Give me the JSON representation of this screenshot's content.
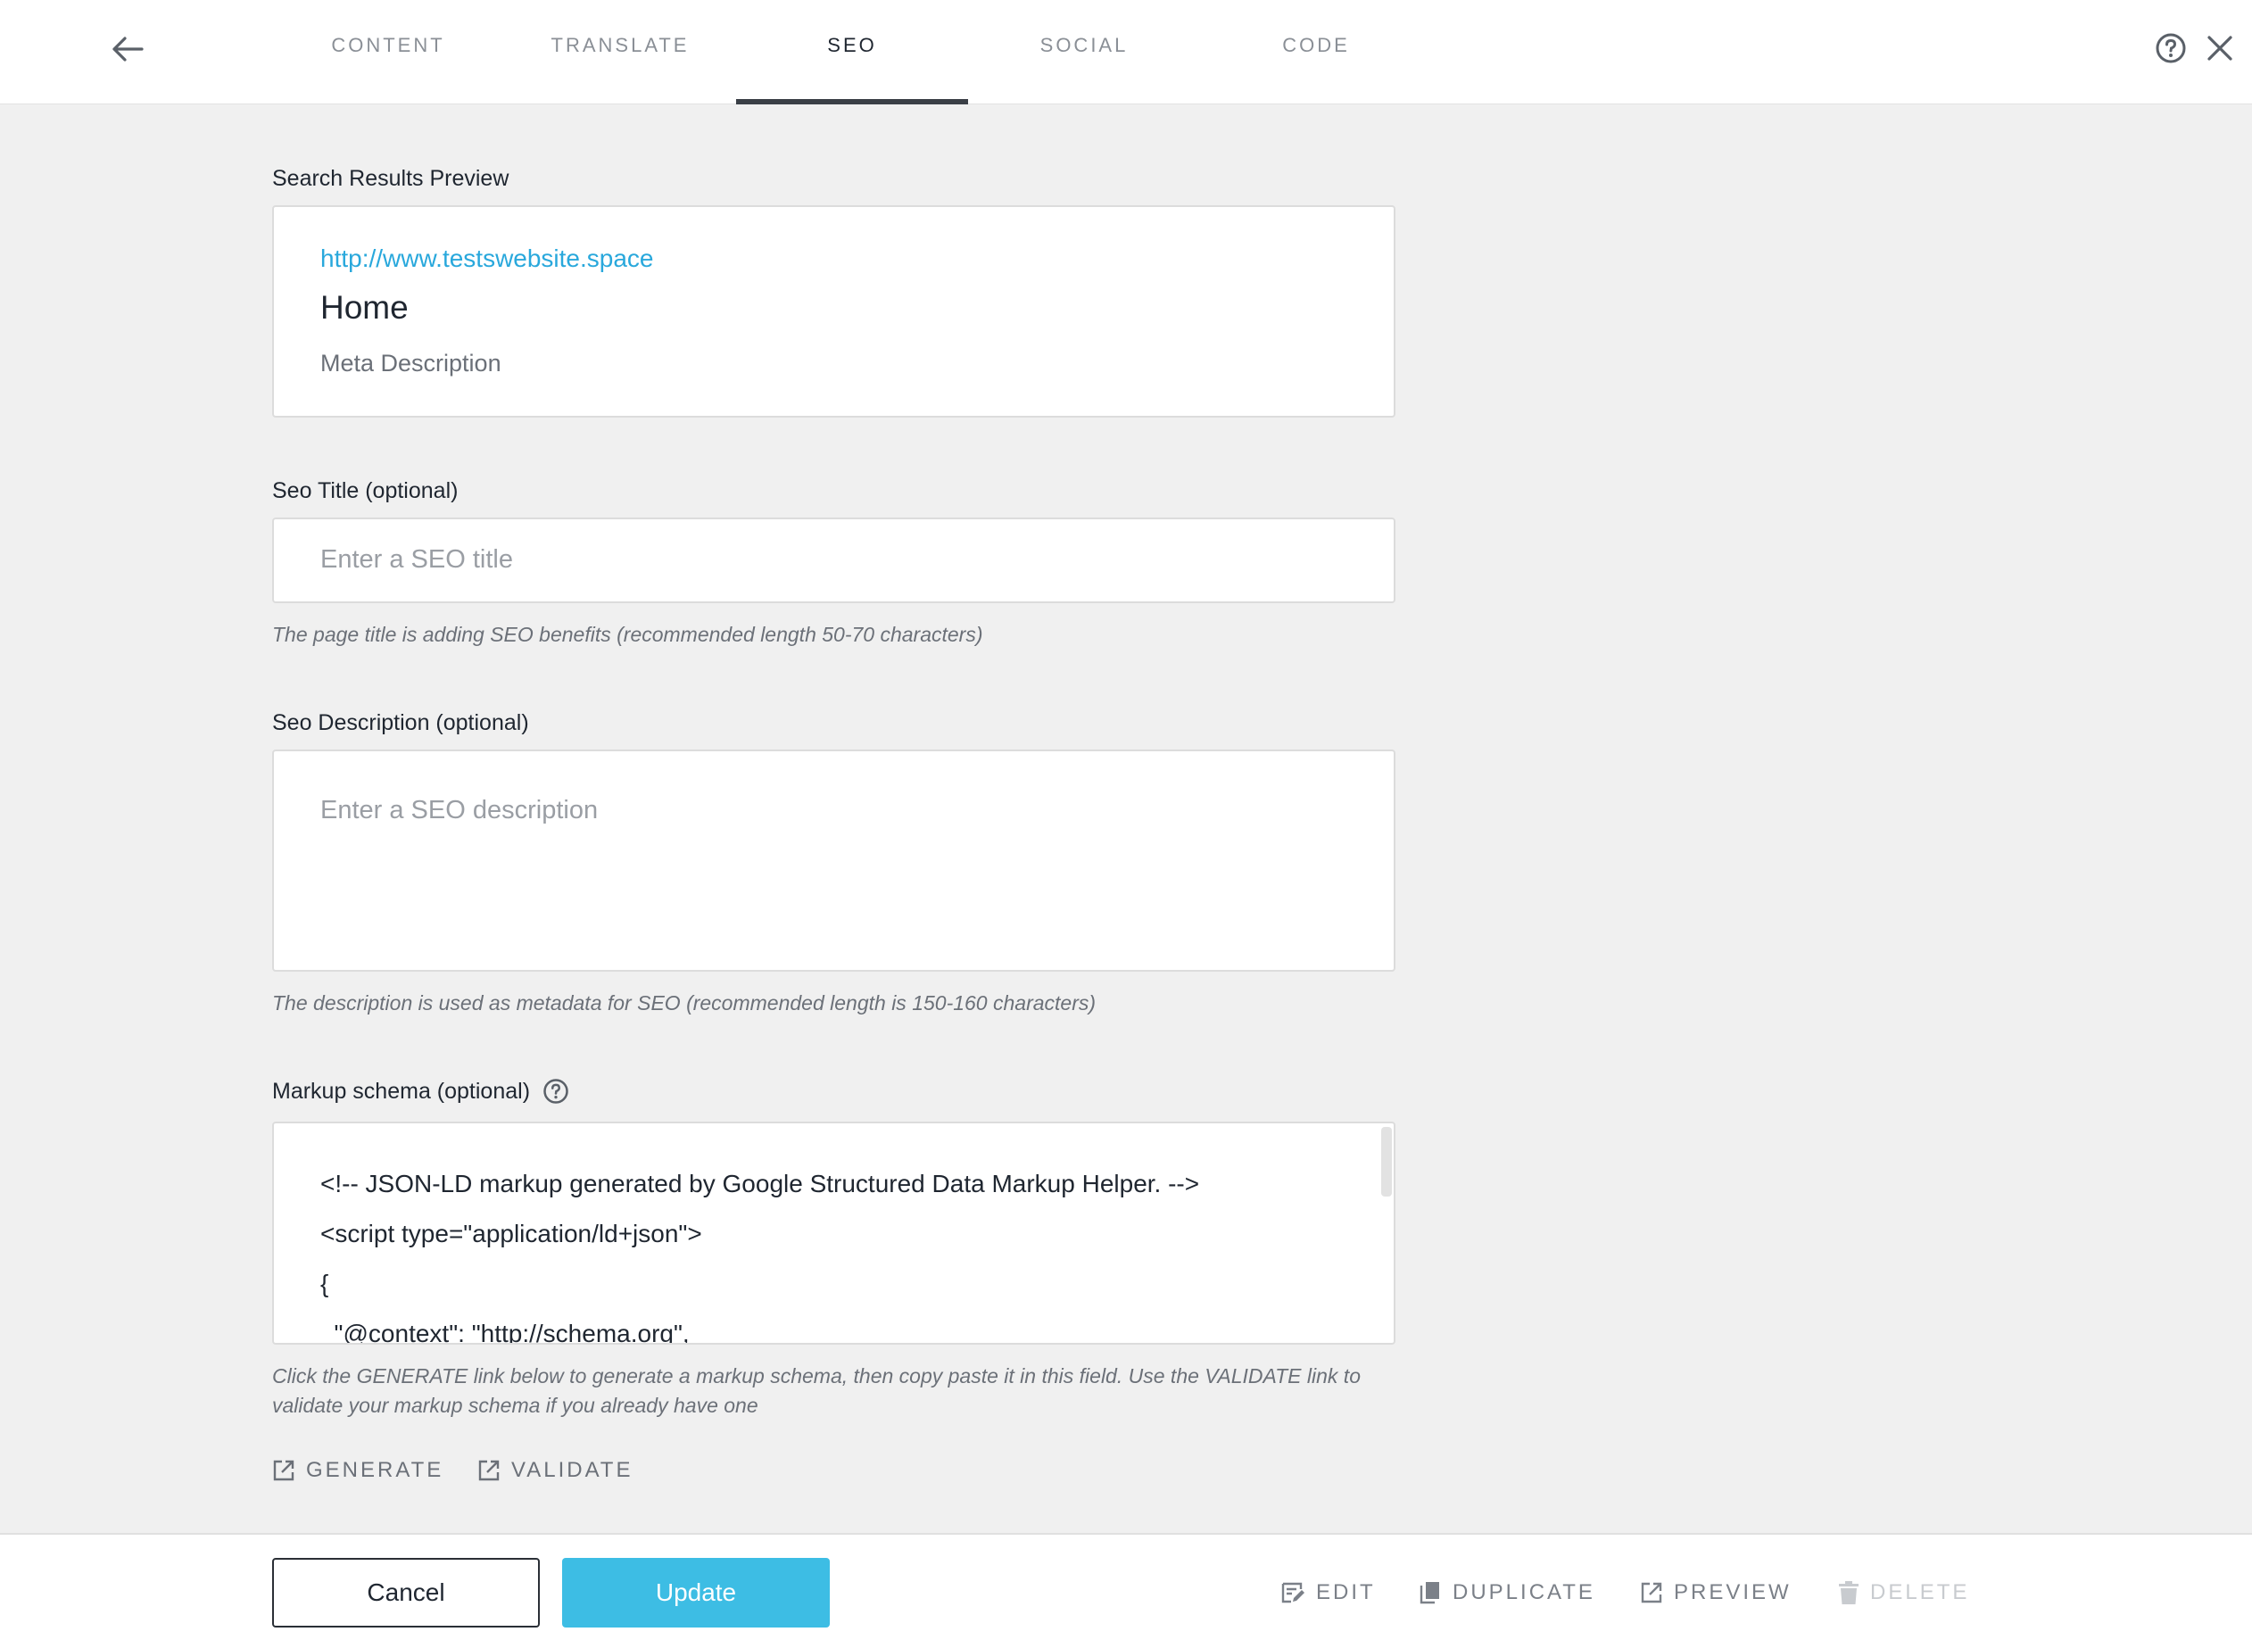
{
  "tabs": [
    {
      "label": "CONTENT"
    },
    {
      "label": "TRANSLATE"
    },
    {
      "label": "SEO",
      "active": true
    },
    {
      "label": "SOCIAL"
    },
    {
      "label": "CODE"
    }
  ],
  "icons": {
    "back": "arrow-left-icon",
    "help": "question-circle-icon",
    "close": "close-icon",
    "external": "external-link-icon",
    "edit": "edit-icon",
    "duplicate": "duplicate-icon",
    "preview": "preview-icon",
    "delete": "trash-icon"
  },
  "colors": {
    "accent": "#3dbde4",
    "link": "#29a8dc",
    "background": "#f0f0f0"
  },
  "search_preview": {
    "label": "Search Results Preview",
    "url": "http://www.testswebsite.space",
    "title": "Home",
    "description": "Meta Description"
  },
  "seo_title": {
    "label": "Seo Title (optional)",
    "placeholder": "Enter a SEO title",
    "hint": "The page title is adding SEO benefits (recommended length 50-70 characters)"
  },
  "seo_description": {
    "label": "Seo Description (optional)",
    "placeholder": "Enter a SEO description",
    "hint": "The description is used as metadata for SEO (recommended length is 150-160 characters)"
  },
  "markup_schema": {
    "label": "Markup schema (optional)",
    "lines": [
      "<!-- JSON-LD markup generated by Google Structured Data Markup Helper. -->",
      "<script type=\"application/ld+json\">",
      "{",
      "  \"@context\": \"http://schema.org\","
    ],
    "hint": "Click the GENERATE link below to generate a markup schema, then copy paste it in this field. Use the VALIDATE link to validate your markup schema if you already have one"
  },
  "links": {
    "generate": "GENERATE",
    "validate": "VALIDATE"
  },
  "footer": {
    "cancel": "Cancel",
    "update": "Update",
    "edit": "EDIT",
    "duplicate": "DUPLICATE",
    "preview": "PREVIEW",
    "delete": "DELETE"
  }
}
